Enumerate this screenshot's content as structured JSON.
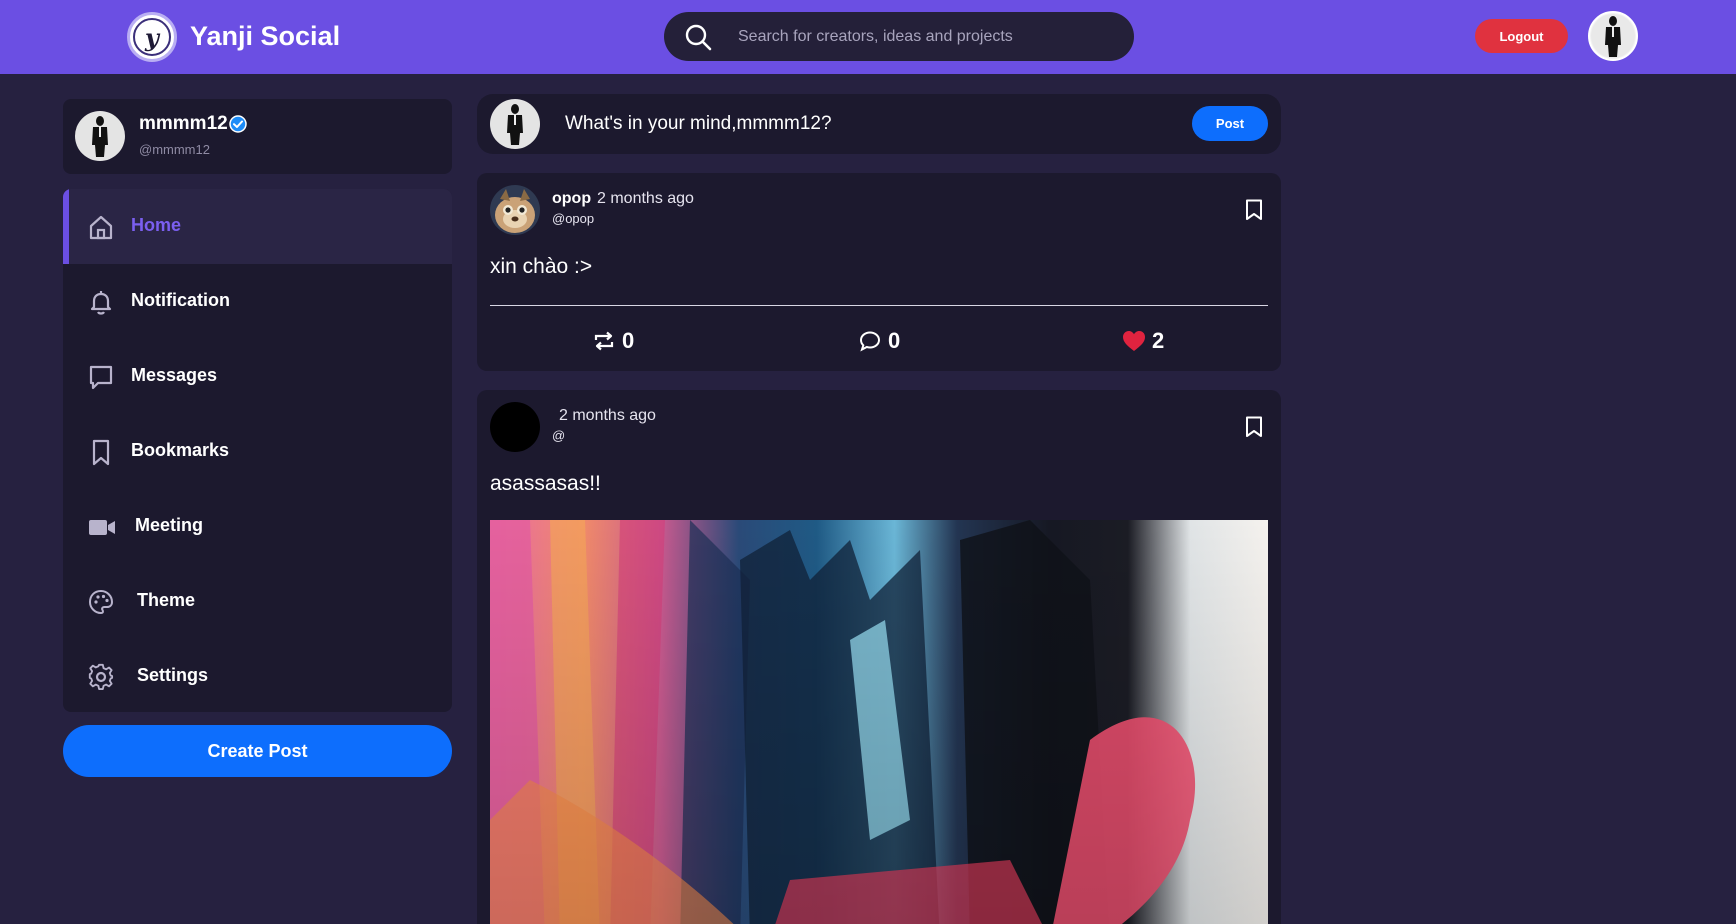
{
  "app": {
    "brand": "Yanji Social",
    "logo_letter": "y"
  },
  "header": {
    "search_placeholder": "Search for creators, ideas and projects",
    "logout_label": "Logout"
  },
  "profile": {
    "name": "mmmm12",
    "handle": "@mmmm12"
  },
  "nav": {
    "items": [
      {
        "label": "Home",
        "icon": "home-icon",
        "active": true
      },
      {
        "label": "Notification",
        "icon": "bell-icon"
      },
      {
        "label": "Messages",
        "icon": "message-icon"
      },
      {
        "label": "Bookmarks",
        "icon": "bookmark-icon"
      },
      {
        "label": "Meeting",
        "icon": "video-icon"
      },
      {
        "label": "Theme",
        "icon": "palette-icon"
      },
      {
        "label": "Settings",
        "icon": "gear-icon"
      }
    ],
    "create_post_label": "Create Post"
  },
  "composer": {
    "placeholder": "What's in your mind,mmmm12?",
    "post_label": "Post"
  },
  "posts": [
    {
      "author": "opop",
      "time": "2 months ago",
      "handle": "@opop",
      "text": "xin chào :>",
      "reposts": "0",
      "comments": "0",
      "likes": "2"
    },
    {
      "author": "",
      "time": "2 months ago",
      "handle": "@",
      "text": "asassasas!!"
    }
  ],
  "colors": {
    "background": "#262140",
    "topbar": "#6b4fe3",
    "card": "#1c192e",
    "primary_button": "#0d6efd",
    "logout_button": "#e0323f",
    "like": "#e0233f",
    "verified": "#1d8cf8"
  }
}
